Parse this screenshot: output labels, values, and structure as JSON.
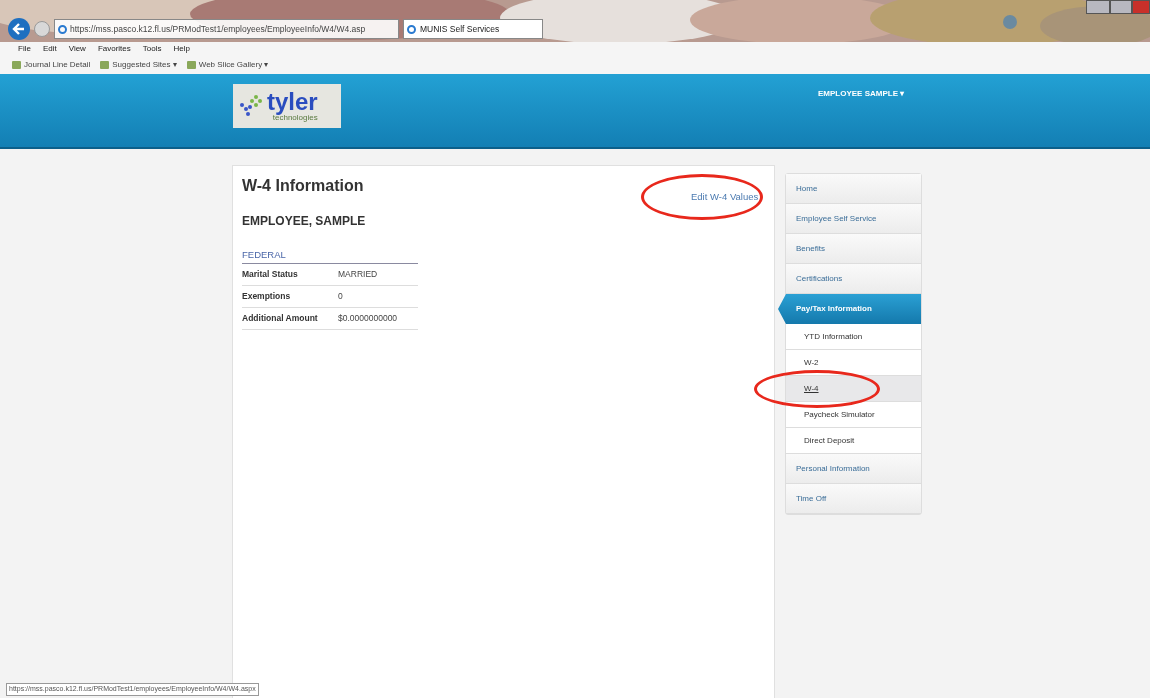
{
  "browser": {
    "address": "https://mss.pasco.k12.fl.us/PRModTest1/employees/EmployeeInfo/W4/W4.asp",
    "tab_title": "MUNIS Self Services",
    "menu": [
      "File",
      "Edit",
      "View",
      "Favorites",
      "Tools",
      "Help"
    ],
    "favorites": [
      "Journal Line Detail",
      "Suggested Sites ▾",
      "Web Slice Gallery ▾"
    ],
    "status_url": "https://mss.pasco.k12.fl.us/PRModTest1/employees/EmployeeInfo/W4/W4.aspx"
  },
  "header": {
    "logo_text": "tyler",
    "logo_sub": "technologies",
    "user_menu": "EMPLOYEE SAMPLE ▾"
  },
  "page": {
    "title": "W-4 Information",
    "employee": "EMPLOYEE, SAMPLE",
    "edit_link": {
      "label": "Edit W-4 Values",
      "circled": true
    },
    "section": "FEDERAL",
    "rows": [
      {
        "label": "Marital Status",
        "value": "MARRIED"
      },
      {
        "label": "Exemptions",
        "value": "0"
      },
      {
        "label": "Additional Amount",
        "value": "$0.0000000000"
      }
    ]
  },
  "sidebar": [
    {
      "label": "Home",
      "selected": false,
      "circled": false
    },
    {
      "label": "Employee Self Service",
      "selected": false,
      "circled": false
    },
    {
      "label": "Benefits",
      "selected": false,
      "circled": false
    },
    {
      "label": "Certifications",
      "selected": false,
      "circled": false
    },
    {
      "label": "Pay/Tax Information",
      "selected": true,
      "circled": false,
      "children": [
        {
          "label": "YTD Information",
          "selected": false,
          "circled": false
        },
        {
          "label": "W-2",
          "selected": false,
          "circled": false
        },
        {
          "label": "W-4",
          "selected": true,
          "circled": true
        },
        {
          "label": "Paycheck Simulator",
          "selected": false,
          "circled": false
        },
        {
          "label": "Direct Deposit",
          "selected": false,
          "circled": false
        }
      ]
    },
    {
      "label": "Personal Information",
      "selected": false,
      "circled": false
    },
    {
      "label": "Time Off",
      "selected": false,
      "circled": false
    }
  ]
}
